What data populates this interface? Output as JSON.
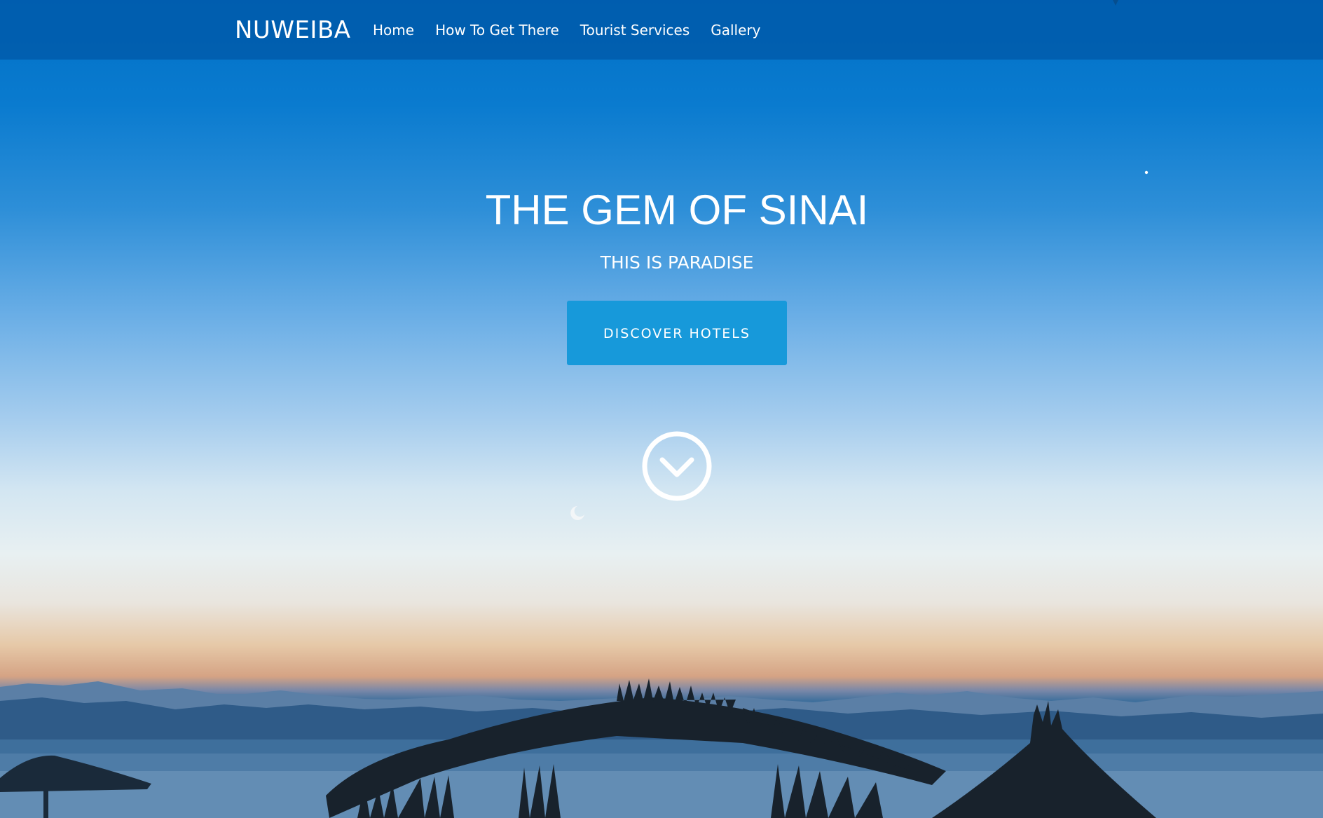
{
  "navbar": {
    "brand": "NUWEIBA",
    "links": [
      {
        "label": "Home"
      },
      {
        "label": "How To Get There"
      },
      {
        "label": "Tourist Services"
      },
      {
        "label": "Gallery"
      }
    ]
  },
  "hero": {
    "title": "THE GEM OF SINAI",
    "subtitle": "THIS IS PARADISE",
    "cta_label": "DISCOVER HOTELS",
    "scroll_icon": "chevron-down-circle-icon"
  },
  "colors": {
    "navbar_bg": "#0058a8",
    "cta_bg": "#1799da",
    "text": "#ffffff"
  }
}
